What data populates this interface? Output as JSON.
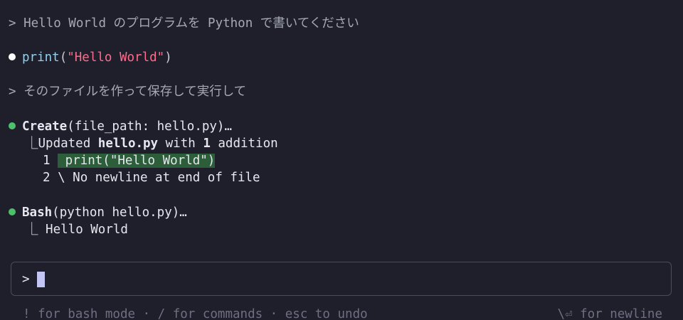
{
  "conversation": {
    "user1": {
      "prompt_symbol": ">",
      "text": "Hello World のプログラムを Python で書いてください"
    },
    "reply1": {
      "fn": "print",
      "open": "(",
      "string": "\"Hello World\"",
      "close": ")"
    },
    "user2": {
      "prompt_symbol": ">",
      "text": "そのファイルを作って保存して実行して"
    },
    "tool_create": {
      "name": "Create",
      "args": "(file_path: hello.py)…",
      "result_prefix": "⎿Updated ",
      "result_file": "hello.py",
      "result_mid": " with ",
      "result_count": "1",
      "result_suffix": " addition",
      "diff": [
        {
          "line_no": "1",
          "content": " print(\"Hello World\")"
        },
        {
          "line_no": "2",
          "content": " \\ No newline at end of file"
        }
      ]
    },
    "tool_bash": {
      "name": "Bash",
      "args": "(python hello.py)…",
      "output_prefix": "⎿ ",
      "output": "Hello World"
    }
  },
  "input": {
    "prompt_symbol": ">",
    "value": ""
  },
  "footer": {
    "left_hint": "! for bash mode · / for commands · esc to undo",
    "right_hint": "\\⏎ for newline"
  },
  "colors": {
    "background": "#1e1f2b",
    "bullet_white": "#ffffff",
    "bullet_green": "#4cc06a",
    "diff_added_bg": "#2c5e3a",
    "cursor": "#c3c6f5"
  }
}
